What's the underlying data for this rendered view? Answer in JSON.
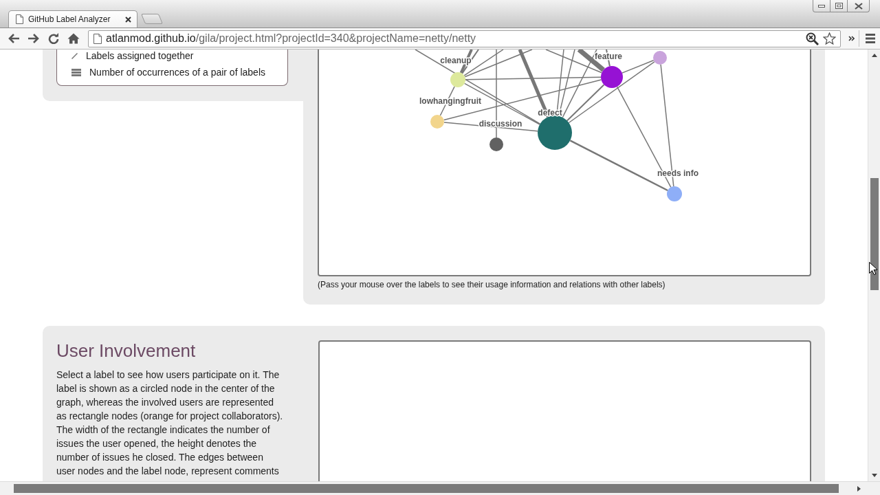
{
  "browser": {
    "tab_title": "GitHub Label Analyzer",
    "url_host": "atlanmod.github.io",
    "url_path": "/gila/project.html?projectId=340&projectName=netty/netty"
  },
  "label_graph": {
    "legend": [
      {
        "kind": "line",
        "label": "Labels assigned together"
      },
      {
        "kind": "bars",
        "label": "Number of occurrences of a pair of labels"
      }
    ],
    "nodes": [
      {
        "color": "#c9a3dc"
      },
      {
        "label": "feature",
        "color": "#9612d4"
      },
      {
        "label": "cleanup",
        "color": "#dde99c"
      },
      {
        "label": "lowhangingfruit",
        "color": "#f2d58c"
      },
      {
        "label": "defect",
        "color": "#1f6e6c"
      },
      {
        "label": "discussion",
        "color": "#616161"
      },
      {
        "label": "needs info",
        "color": "#8eaef7"
      }
    ],
    "caption": "(Pass your mouse over the labels to see their usage information and relations with other labels)"
  },
  "user_involvement": {
    "title": "User Involvement",
    "description": "Select a label to see how users participate on it. The label is shown as a circled node in the center of the graph, whereas the involved users are represented as rectangle nodes (orange for project collaborators). The width of the rectangle indicates the number of issues the user opened, the height denotes the number of issues he closed. The edges between user nodes and the label node, represent comments"
  }
}
